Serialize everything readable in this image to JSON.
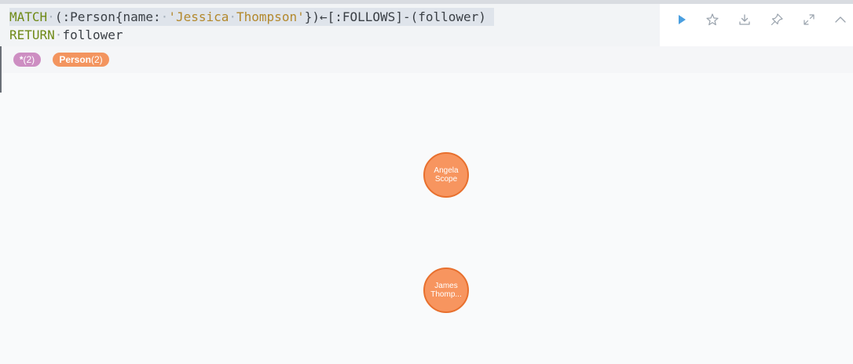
{
  "query": {
    "line1": [
      {
        "t": "MATCH",
        "c": "kw"
      },
      {
        "t": "·",
        "c": "dot"
      },
      {
        "t": "(:Person{name:",
        "c": "plain"
      },
      {
        "t": "·",
        "c": "dot"
      },
      {
        "t": "'Jessica",
        "c": "str"
      },
      {
        "t": "·",
        "c": "dot"
      },
      {
        "t": "Thompson'",
        "c": "str"
      },
      {
        "t": "})←[:FOLLOWS]-(follower)",
        "c": "plain"
      },
      {
        "t": " ",
        "c": "plain"
      }
    ],
    "line2": [
      {
        "t": "RETURN",
        "c": "kw"
      },
      {
        "t": "·",
        "c": "dot"
      },
      {
        "t": "follower",
        "c": "plain"
      }
    ]
  },
  "actions": [
    {
      "name": "run-query-button",
      "icon": "play-icon"
    },
    {
      "name": "favorite-button",
      "icon": "star-icon"
    },
    {
      "name": "export-button",
      "icon": "download-icon"
    },
    {
      "name": "pin-button",
      "icon": "pin-icon"
    },
    {
      "name": "fullscreen-button",
      "icon": "expand-icon"
    },
    {
      "name": "collapse-button",
      "icon": "chevron-up-icon"
    }
  ],
  "legend": {
    "all": {
      "label": "*",
      "count": "(2)",
      "color": "#cd8ec2"
    },
    "person": {
      "label": "Person",
      "count": "(2)",
      "color": "#f3955f"
    }
  },
  "nodes": [
    {
      "label_line1": "Angela",
      "label_line2": "Scope"
    },
    {
      "label_line1": "James",
      "label_line2": "Thomp..."
    }
  ],
  "colors": {
    "accent": "#4a9fe0",
    "node_fill": "#f7955f",
    "node_border": "#e8702e"
  }
}
